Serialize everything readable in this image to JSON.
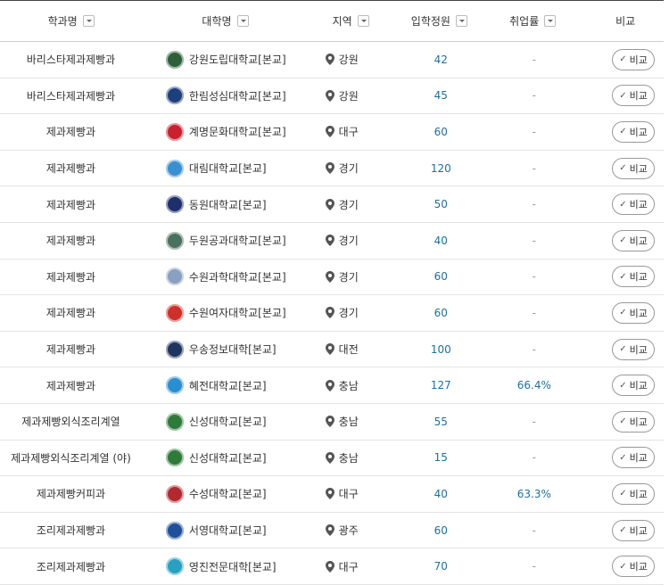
{
  "headers": {
    "dept": "학과명",
    "univ": "대학명",
    "region": "지역",
    "quota": "입학정원",
    "employment": "취업률",
    "compare": "비교"
  },
  "compare_label": "비교",
  "rows": [
    {
      "dept": "바리스타제과제빵과",
      "univ": "강원도립대학교[본교]",
      "region": "강원",
      "quota": "42",
      "employment": "-",
      "logo_color": "#2e5f3a",
      "logo_icon": "emblem-icon"
    },
    {
      "dept": "바리스타제과제빵과",
      "univ": "한림성심대학교[본교]",
      "region": "강원",
      "quota": "45",
      "employment": "-",
      "logo_color": "#1f3f7a",
      "logo_icon": "emblem-icon"
    },
    {
      "dept": "제과제빵과",
      "univ": "계명문화대학교[본교]",
      "region": "대구",
      "quota": "60",
      "employment": "-",
      "logo_color": "#c8202f",
      "logo_icon": "shield-icon"
    },
    {
      "dept": "제과제빵과",
      "univ": "대림대학교[본교]",
      "region": "경기",
      "quota": "120",
      "employment": "-",
      "logo_color": "#3a8fd0",
      "logo_icon": "emblem-icon"
    },
    {
      "dept": "제과제빵과",
      "univ": "동원대학교[본교]",
      "region": "경기",
      "quota": "50",
      "employment": "-",
      "logo_color": "#1f2f6a",
      "logo_icon": "emblem-icon"
    },
    {
      "dept": "제과제빵과",
      "univ": "두원공과대학교[본교]",
      "region": "경기",
      "quota": "40",
      "employment": "-",
      "logo_color": "#4a7060",
      "logo_icon": "building-icon"
    },
    {
      "dept": "제과제빵과",
      "univ": "수원과학대학교[본교]",
      "region": "경기",
      "quota": "60",
      "employment": "-",
      "logo_color": "#8aa0c0",
      "logo_icon": "emblem-icon"
    },
    {
      "dept": "제과제빵과",
      "univ": "수원여자대학교[본교]",
      "region": "경기",
      "quota": "60",
      "employment": "-",
      "logo_color": "#d0302a",
      "logo_icon": "emblem-icon"
    },
    {
      "dept": "제과제빵과",
      "univ": "우송정보대학[본교]",
      "region": "대전",
      "quota": "100",
      "employment": "-",
      "logo_color": "#1f3560",
      "logo_icon": "text-logo-icon"
    },
    {
      "dept": "제과제빵과",
      "univ": "혜전대학교[본교]",
      "region": "충남",
      "quota": "127",
      "employment": "66.4%",
      "logo_color": "#2a8fd0",
      "logo_icon": "emblem-icon"
    },
    {
      "dept": "제과제빵외식조리계열",
      "univ": "신성대학교[본교]",
      "region": "충남",
      "quota": "55",
      "employment": "-",
      "logo_color": "#2f7a3a",
      "logo_icon": "emblem-icon"
    },
    {
      "dept": "제과제빵외식조리계열 (야)",
      "univ": "신성대학교[본교]",
      "region": "충남",
      "quota": "15",
      "employment": "-",
      "logo_color": "#2f7a3a",
      "logo_icon": "emblem-icon"
    },
    {
      "dept": "제과제빵커피과",
      "univ": "수성대학교[본교]",
      "region": "대구",
      "quota": "40",
      "employment": "63.3%",
      "logo_color": "#b02a30",
      "logo_icon": "emblem-icon"
    },
    {
      "dept": "조리제과제빵과",
      "univ": "서영대학교[본교]",
      "region": "광주",
      "quota": "60",
      "employment": "-",
      "logo_color": "#1f4f9a",
      "logo_icon": "emblem-icon"
    },
    {
      "dept": "조리제과제빵과",
      "univ": "영진전문대학[본교]",
      "region": "대구",
      "quota": "70",
      "employment": "-",
      "logo_color": "#2aa0c0",
      "logo_icon": "emblem-icon"
    }
  ]
}
